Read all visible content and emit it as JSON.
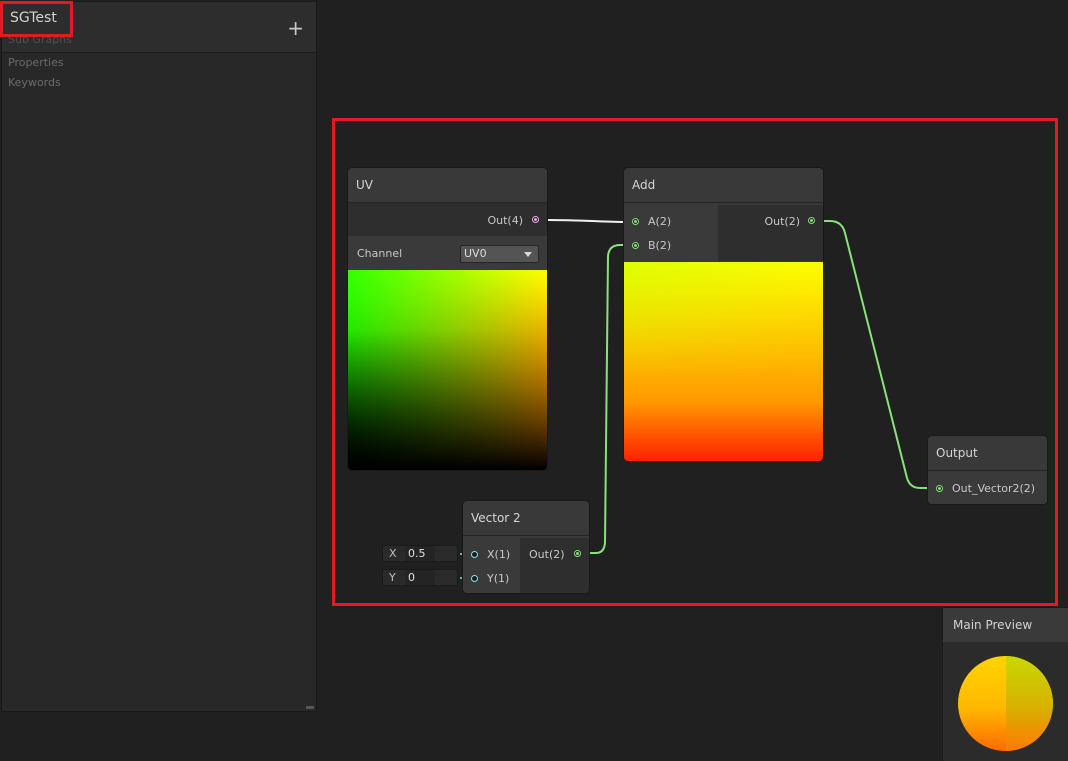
{
  "blackboard": {
    "title": "SGTest",
    "subtitle": "Sub Graphs",
    "add_label": "+",
    "sections": [
      "Properties",
      "Keywords"
    ]
  },
  "nodes": {
    "uv": {
      "title": "UV",
      "output": "Out(4)",
      "channel_label": "Channel",
      "channel_value": "UV0"
    },
    "add": {
      "title": "Add",
      "input_a": "A(2)",
      "input_b": "B(2)",
      "output": "Out(2)"
    },
    "vector2": {
      "title": "Vector 2",
      "input_x": "X(1)",
      "input_y": "Y(1)",
      "output": "Out(2)",
      "x_field_label": "X",
      "x_value": "0.5",
      "y_field_label": "Y",
      "y_value": "0"
    },
    "output": {
      "title": "Output",
      "input": "Out_Vector2(2)"
    }
  },
  "main_preview": {
    "title": "Main Preview"
  },
  "colors": {
    "highlight": "#e01b24",
    "vector_edge": "#88e27a",
    "vector4_port": "#f1a6f0",
    "float_port": "#84e4e7"
  }
}
